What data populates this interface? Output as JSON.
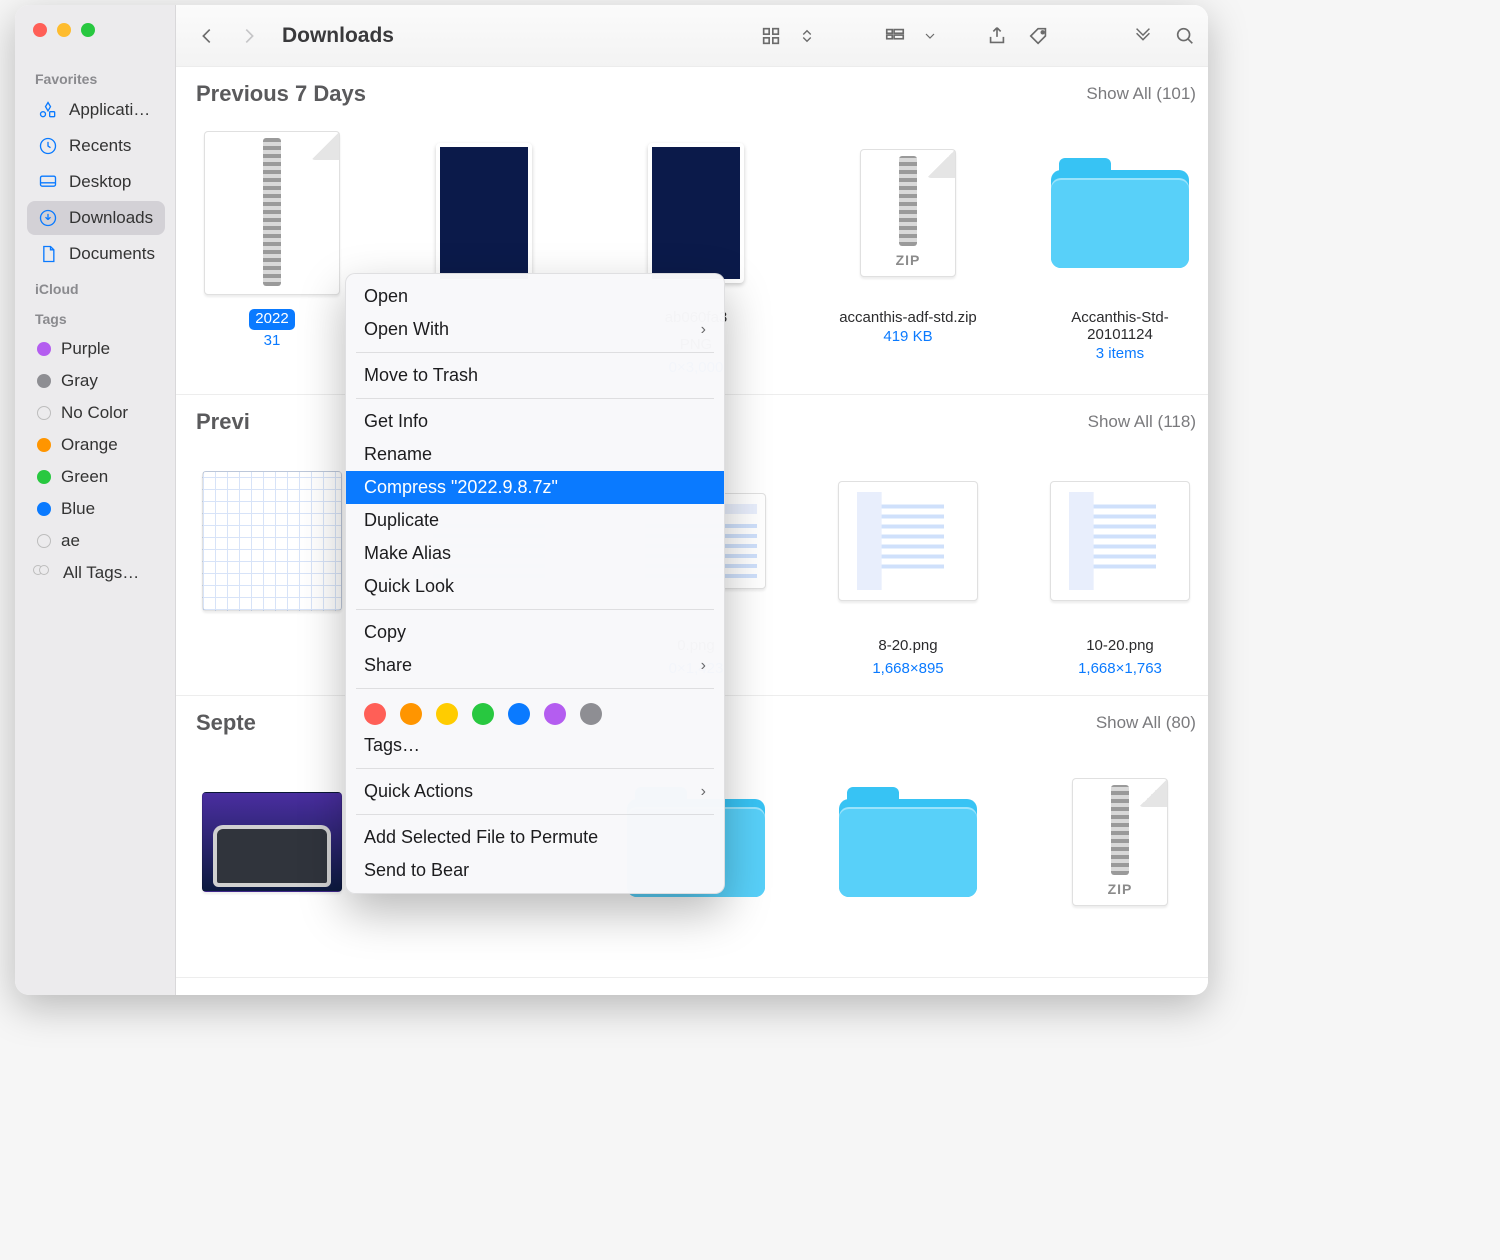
{
  "window": {
    "title": "Downloads"
  },
  "toolbar": {
    "back_enabled": true,
    "forward_enabled": false
  },
  "sidebar": {
    "favorites_label": "Favorites",
    "icloud_label": "iCloud",
    "tags_label": "Tags",
    "favorites": [
      {
        "label": "Applicati…",
        "icon": "apps"
      },
      {
        "label": "Recents",
        "icon": "recents"
      },
      {
        "label": "Desktop",
        "icon": "desktop"
      },
      {
        "label": "Downloads",
        "icon": "downloads",
        "active": true
      },
      {
        "label": "Documents",
        "icon": "documents"
      }
    ],
    "tags": [
      {
        "label": "Purple",
        "color": "#b45df0"
      },
      {
        "label": "Gray",
        "color": "#8e8e93"
      },
      {
        "label": "No Color",
        "color": null
      },
      {
        "label": "Orange",
        "color": "#ff9500"
      },
      {
        "label": "Green",
        "color": "#28c840"
      },
      {
        "label": "Blue",
        "color": "#0a7aff"
      },
      {
        "label": "ae",
        "color": null
      },
      {
        "label": "All Tags…",
        "color": "multi"
      }
    ]
  },
  "groups": [
    {
      "title": "Previous 7 Days",
      "showall": "Show All (101)",
      "files": [
        {
          "name": "2022",
          "info": "31",
          "kind": "7z",
          "selected": true
        },
        {
          "name": "",
          "info": "",
          "kind": "png-dark"
        },
        {
          "name": "ab060fa3",
          "info": "0×3,000",
          "ext": "PNG",
          "kind": "png-dark"
        },
        {
          "name": "accanthis-adf-std.zip",
          "info": "419 KB",
          "kind": "zip"
        },
        {
          "name": "Accanthis-Std-20101124",
          "info": "3 items",
          "kind": "folder"
        }
      ]
    },
    {
      "title": "Previ",
      "showall": "Show All (118)",
      "files": [
        {
          "name": "",
          "info": "",
          "kind": "grid"
        },
        {
          "name": "",
          "info": "",
          "kind": "ui1"
        },
        {
          "name": "0.png",
          "info": "0×1,423",
          "kind": "ui1"
        },
        {
          "name": "8-20.png",
          "info": "1,668×895",
          "kind": "ui2"
        },
        {
          "name": "10-20.png",
          "info": "1,668×1,763",
          "kind": "ui2"
        }
      ]
    },
    {
      "title": "Septe",
      "showall": "Show All (80)",
      "files": [
        {
          "name": "",
          "info": "",
          "kind": "screen"
        },
        {
          "name": "",
          "info": "",
          "kind": "hidden"
        },
        {
          "name": "",
          "info": "",
          "kind": "folder"
        },
        {
          "name": "",
          "info": "",
          "kind": "folder"
        },
        {
          "name": "",
          "info": "",
          "ext": "ZIP",
          "kind": "zip"
        }
      ]
    }
  ],
  "context_menu": {
    "items": [
      {
        "label": "Open"
      },
      {
        "label": "Open With",
        "submenu": true
      },
      {
        "sep": true
      },
      {
        "label": "Move to Trash"
      },
      {
        "sep": true
      },
      {
        "label": "Get Info"
      },
      {
        "label": "Rename"
      },
      {
        "label": "Compress \"2022.9.8.7z\"",
        "highlighted": true
      },
      {
        "label": "Duplicate"
      },
      {
        "label": "Make Alias"
      },
      {
        "label": "Quick Look"
      },
      {
        "sep": true
      },
      {
        "label": "Copy"
      },
      {
        "label": "Share",
        "submenu": true
      },
      {
        "sep": true
      },
      {
        "tag_row": true,
        "colors": [
          "#ff5f57",
          "#ff9500",
          "#ffcc00",
          "#28c840",
          "#0a7aff",
          "#b45df0",
          "#8e8e93"
        ]
      },
      {
        "label": "Tags…"
      },
      {
        "sep": true
      },
      {
        "label": "Quick Actions",
        "submenu": true
      },
      {
        "sep": true
      },
      {
        "label": "Add Selected File to Permute"
      },
      {
        "label": "Send to Bear"
      }
    ]
  }
}
